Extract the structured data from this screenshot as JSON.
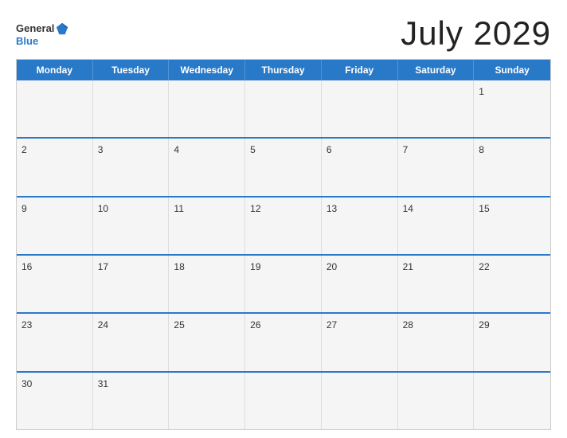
{
  "header": {
    "logo_general": "General",
    "logo_blue": "Blue",
    "month_title": "July 2029"
  },
  "calendar": {
    "weekdays": [
      "Monday",
      "Tuesday",
      "Wednesday",
      "Thursday",
      "Friday",
      "Saturday",
      "Sunday"
    ],
    "rows": [
      [
        {
          "day": "",
          "empty": true
        },
        {
          "day": "",
          "empty": true
        },
        {
          "day": "",
          "empty": true
        },
        {
          "day": "",
          "empty": true
        },
        {
          "day": "",
          "empty": true
        },
        {
          "day": "",
          "empty": true
        },
        {
          "day": "1",
          "empty": false
        }
      ],
      [
        {
          "day": "2",
          "empty": false
        },
        {
          "day": "3",
          "empty": false
        },
        {
          "day": "4",
          "empty": false
        },
        {
          "day": "5",
          "empty": false
        },
        {
          "day": "6",
          "empty": false
        },
        {
          "day": "7",
          "empty": false
        },
        {
          "day": "8",
          "empty": false
        }
      ],
      [
        {
          "day": "9",
          "empty": false
        },
        {
          "day": "10",
          "empty": false
        },
        {
          "day": "11",
          "empty": false
        },
        {
          "day": "12",
          "empty": false
        },
        {
          "day": "13",
          "empty": false
        },
        {
          "day": "14",
          "empty": false
        },
        {
          "day": "15",
          "empty": false
        }
      ],
      [
        {
          "day": "16",
          "empty": false
        },
        {
          "day": "17",
          "empty": false
        },
        {
          "day": "18",
          "empty": false
        },
        {
          "day": "19",
          "empty": false
        },
        {
          "day": "20",
          "empty": false
        },
        {
          "day": "21",
          "empty": false
        },
        {
          "day": "22",
          "empty": false
        }
      ],
      [
        {
          "day": "23",
          "empty": false
        },
        {
          "day": "24",
          "empty": false
        },
        {
          "day": "25",
          "empty": false
        },
        {
          "day": "26",
          "empty": false
        },
        {
          "day": "27",
          "empty": false
        },
        {
          "day": "28",
          "empty": false
        },
        {
          "day": "29",
          "empty": false
        }
      ],
      [
        {
          "day": "30",
          "empty": false
        },
        {
          "day": "31",
          "empty": false
        },
        {
          "day": "",
          "empty": true
        },
        {
          "day": "",
          "empty": true
        },
        {
          "day": "",
          "empty": true
        },
        {
          "day": "",
          "empty": true
        },
        {
          "day": "",
          "empty": true
        }
      ]
    ]
  }
}
